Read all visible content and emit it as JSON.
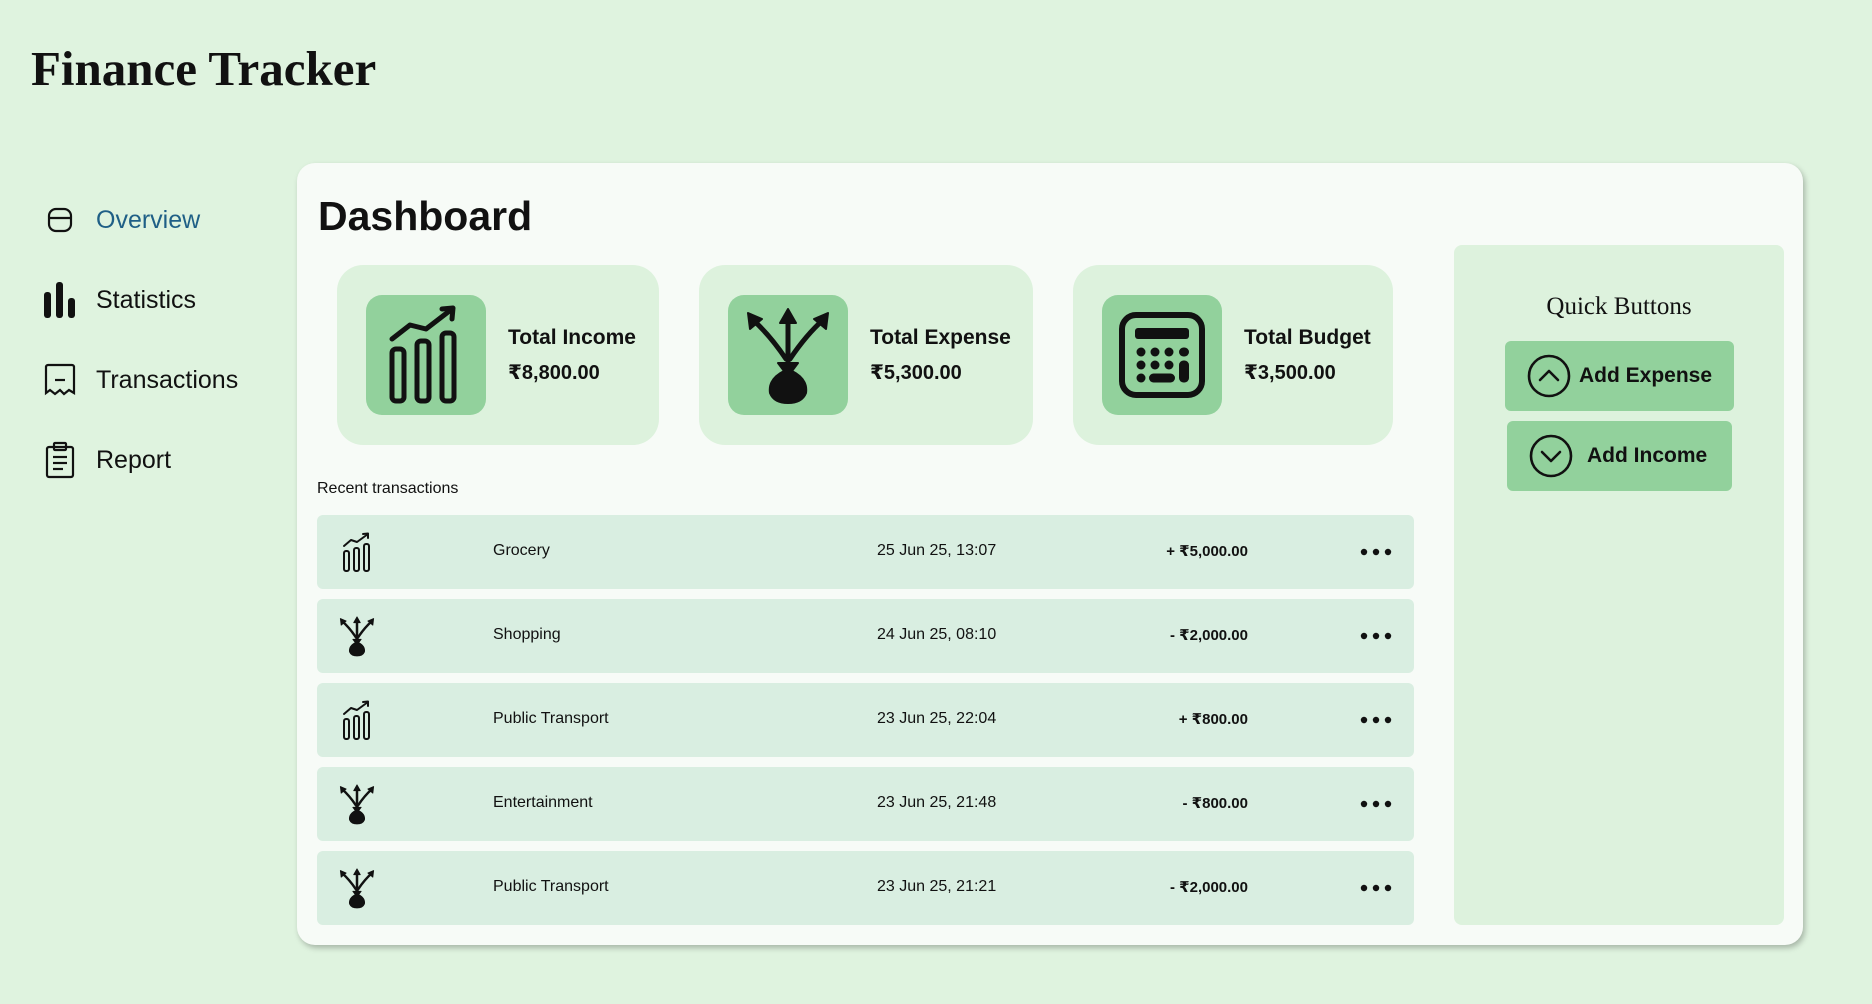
{
  "app": {
    "title": "Finance Tracker"
  },
  "sidebar": {
    "items": [
      {
        "label": "Overview",
        "icon": "overview-icon",
        "active": true
      },
      {
        "label": "Statistics",
        "icon": "bar-chart-icon",
        "active": false
      },
      {
        "label": "Transactions",
        "icon": "receipt-icon",
        "active": false
      },
      {
        "label": "Report",
        "icon": "clipboard-icon",
        "active": false
      }
    ]
  },
  "dashboard": {
    "title": "Dashboard",
    "cards": [
      {
        "label": "Total Income",
        "value": "₹8,800.00",
        "icon": "income-chart-icon"
      },
      {
        "label": "Total Expense",
        "value": "₹5,300.00",
        "icon": "money-bag-arrows-icon"
      },
      {
        "label": "Total Budget",
        "value": "₹3,500.00",
        "icon": "calculator-icon"
      }
    ],
    "recent_label": "Recent transactions",
    "transactions": [
      {
        "name": "Grocery",
        "date": "25 Jun 25, 13:07",
        "amount": "+ ₹5,000.00",
        "type": "income"
      },
      {
        "name": "Shopping",
        "date": "24 Jun 25, 08:10",
        "amount": "- ₹2,000.00",
        "type": "expense"
      },
      {
        "name": "Public Transport",
        "date": "23 Jun 25, 22:04",
        "amount": "+ ₹800.00",
        "type": "income"
      },
      {
        "name": "Entertainment",
        "date": "23 Jun 25, 21:48",
        "amount": "- ₹800.00",
        "type": "expense"
      },
      {
        "name": "Public Transport",
        "date": "23 Jun 25, 21:21",
        "amount": "- ₹2,000.00",
        "type": "expense"
      }
    ]
  },
  "quick": {
    "title": "Quick Buttons",
    "add_expense": "Add Expense",
    "add_income": "Add Income"
  },
  "colors": {
    "background": "#dff3df",
    "panel": "#f7fbf7",
    "card": "#ddf2dd",
    "accent": "#92d19c",
    "row": "#d9eee1",
    "active_nav": "#1f5f86"
  }
}
